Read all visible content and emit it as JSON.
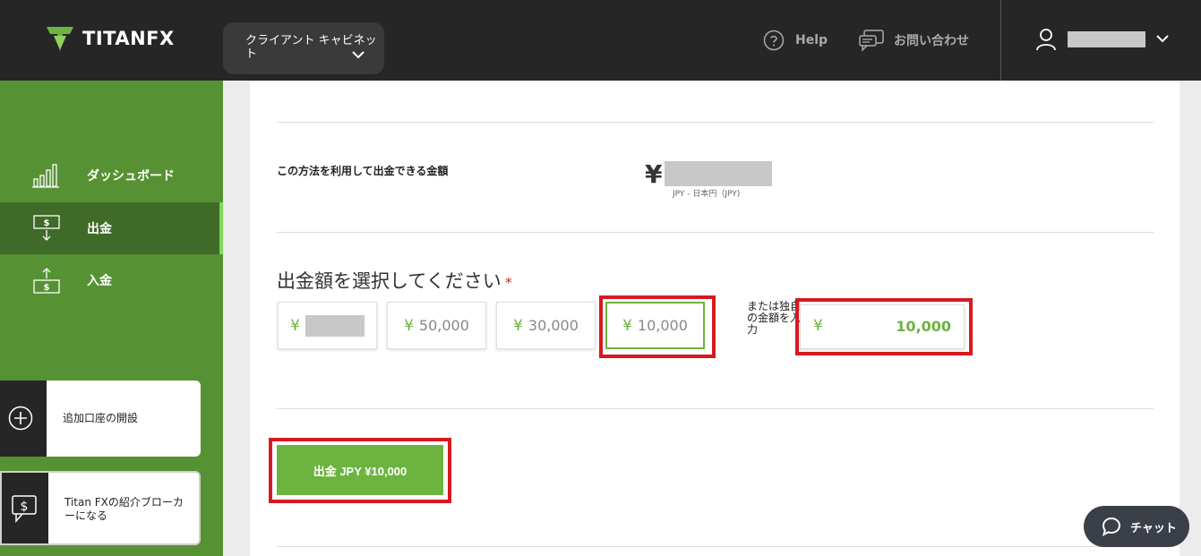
{
  "header": {
    "logo_text": "TITANFX",
    "cabinet_label": "クライアント キャビネット",
    "help_label": "Help",
    "contact_label": "お問い合わせ"
  },
  "sidebar": {
    "items": [
      {
        "label": "ダッシュボード",
        "icon": "chart-icon"
      },
      {
        "label": "出金",
        "icon": "withdraw-icon",
        "active": true
      },
      {
        "label": "入金",
        "icon": "deposit-icon"
      }
    ],
    "cards": [
      {
        "label": "追加口座の開設",
        "icon": "plus-circle-icon"
      },
      {
        "label": "Titan FXの紹介ブローカーになる",
        "icon": "dollar-chat-icon"
      }
    ]
  },
  "main": {
    "available_label": "この方法を利用して出金できる金額",
    "available_currency_symbol": "¥",
    "currency_note": "JPY - 日本円（JPY)",
    "select_title": "出金額を選択してください",
    "required_mark": "*",
    "amount_options": [
      {
        "symbol": "¥",
        "value": "",
        "masked": true
      },
      {
        "symbol": "¥",
        "value": "50,000"
      },
      {
        "symbol": "¥",
        "value": "30,000"
      },
      {
        "symbol": "¥",
        "value": "10,000",
        "selected": true
      }
    ],
    "or_label": "または独自の金額を入力",
    "custom_symbol": "¥",
    "custom_value": "10,000",
    "submit_label": "出金 JPY ¥10,000"
  },
  "chat": {
    "label": "チャット"
  },
  "colors": {
    "brand_green": "#6cb33f",
    "sidebar_green": "#569233",
    "highlight_red": "#d71920",
    "topbar": "#262626"
  }
}
